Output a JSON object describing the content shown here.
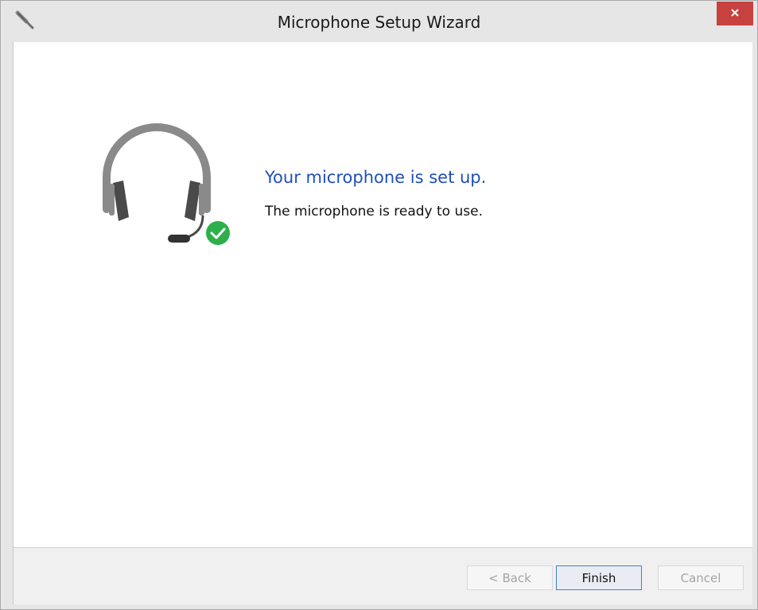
{
  "window": {
    "title": "Microphone Setup Wizard",
    "app_icon": "microphone-icon",
    "close_icon": "close-icon"
  },
  "main": {
    "illustration": "headset-check-icon",
    "heading": "Your microphone is set up.",
    "message": "The microphone is ready to use."
  },
  "footer": {
    "back_label": "< Back",
    "finish_label": "Finish",
    "cancel_label": "Cancel",
    "back_enabled": false,
    "cancel_enabled": false
  },
  "colors": {
    "heading": "#1f4fbd",
    "close_button": "#c7423f",
    "check_badge": "#2db04a",
    "default_button_border": "#3c82d6"
  }
}
